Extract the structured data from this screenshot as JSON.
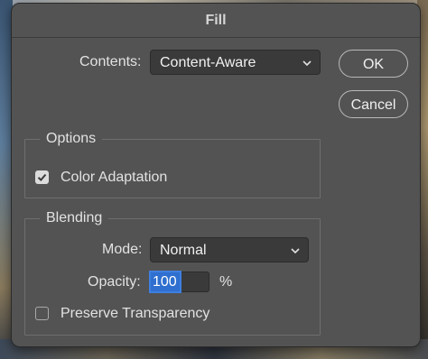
{
  "dialog": {
    "title": "Fill",
    "contents_label": "Contents:",
    "contents_value": "Content-Aware",
    "ok_label": "OK",
    "cancel_label": "Cancel",
    "options": {
      "legend": "Options",
      "color_adaptation_label": "Color Adaptation",
      "color_adaptation_checked": true
    },
    "blending": {
      "legend": "Blending",
      "mode_label": "Mode:",
      "mode_value": "Normal",
      "opacity_label": "Opacity:",
      "opacity_value": "100",
      "opacity_unit": "%",
      "preserve_transparency_label": "Preserve Transparency",
      "preserve_transparency_checked": false
    }
  },
  "icons": {
    "dropdown": "chevron-down-icon",
    "check": "checkmark-icon"
  },
  "colors": {
    "dialog_bg": "#535353",
    "field_bg": "#3a3a3a",
    "selection": "#2e6fcf"
  }
}
